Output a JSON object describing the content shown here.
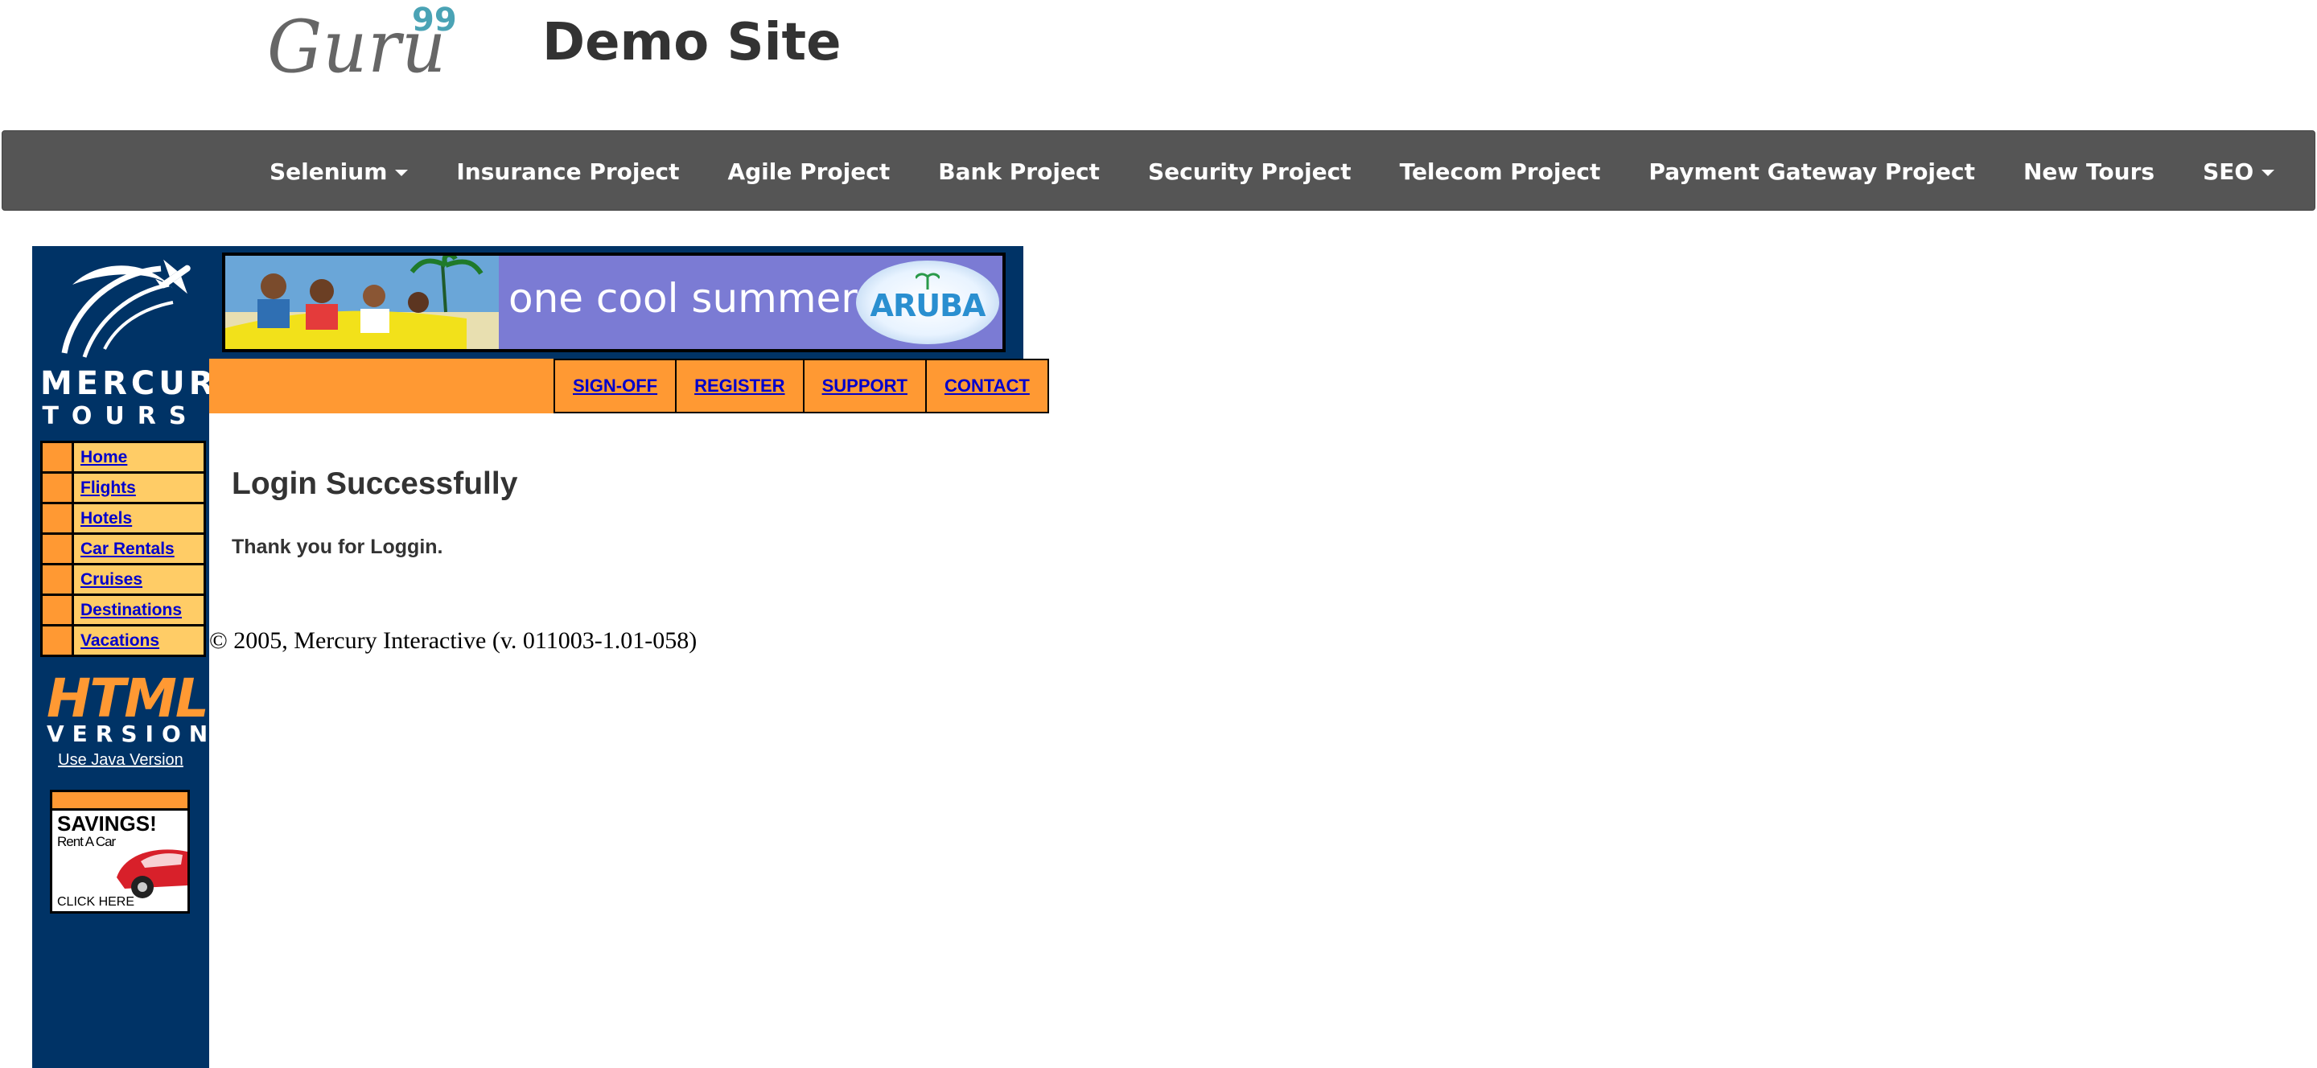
{
  "header": {
    "logo_text": "Guru",
    "logo_superscript": "99",
    "site_title": "Demo Site"
  },
  "nav": {
    "items": [
      {
        "label": "Selenium",
        "has_dropdown": true
      },
      {
        "label": "Insurance Project"
      },
      {
        "label": "Agile Project"
      },
      {
        "label": "Bank Project"
      },
      {
        "label": "Security Project"
      },
      {
        "label": "Telecom Project"
      },
      {
        "label": "Payment Gateway Project"
      },
      {
        "label": "New Tours"
      },
      {
        "label": "SEO",
        "has_dropdown": true
      }
    ]
  },
  "mercury": {
    "logo_word": "MERCURY",
    "logo_sub": "TOURS",
    "banner_text": "one cool summer",
    "banner_brand": "ARUBA",
    "top_links": [
      "SIGN-OFF",
      "REGISTER",
      "SUPPORT",
      "CONTACT"
    ],
    "side_menu": [
      "Home",
      "Flights",
      "Hotels",
      "Car Rentals",
      "Cruises",
      "Destinations",
      "Vacations"
    ],
    "html_badge": "HTML",
    "version_label": "VERSION",
    "java_link": "Use Java Version",
    "ad": {
      "title": "SAVINGS!",
      "subtitle": "Rent A Car",
      "cta": "CLICK HERE"
    }
  },
  "content": {
    "heading": "Login Successfully",
    "message": "Thank you for Loggin.",
    "copyright": "© 2005, Mercury Interactive (v. 011003-1.01-058)"
  },
  "colors": {
    "navbar": "#555555",
    "mercury_blue": "#003366",
    "orange": "#ff9933",
    "menu_yellow": "#ffcc66",
    "link_blue": "#0000cc",
    "logo_accent": "#4aa3b5"
  }
}
